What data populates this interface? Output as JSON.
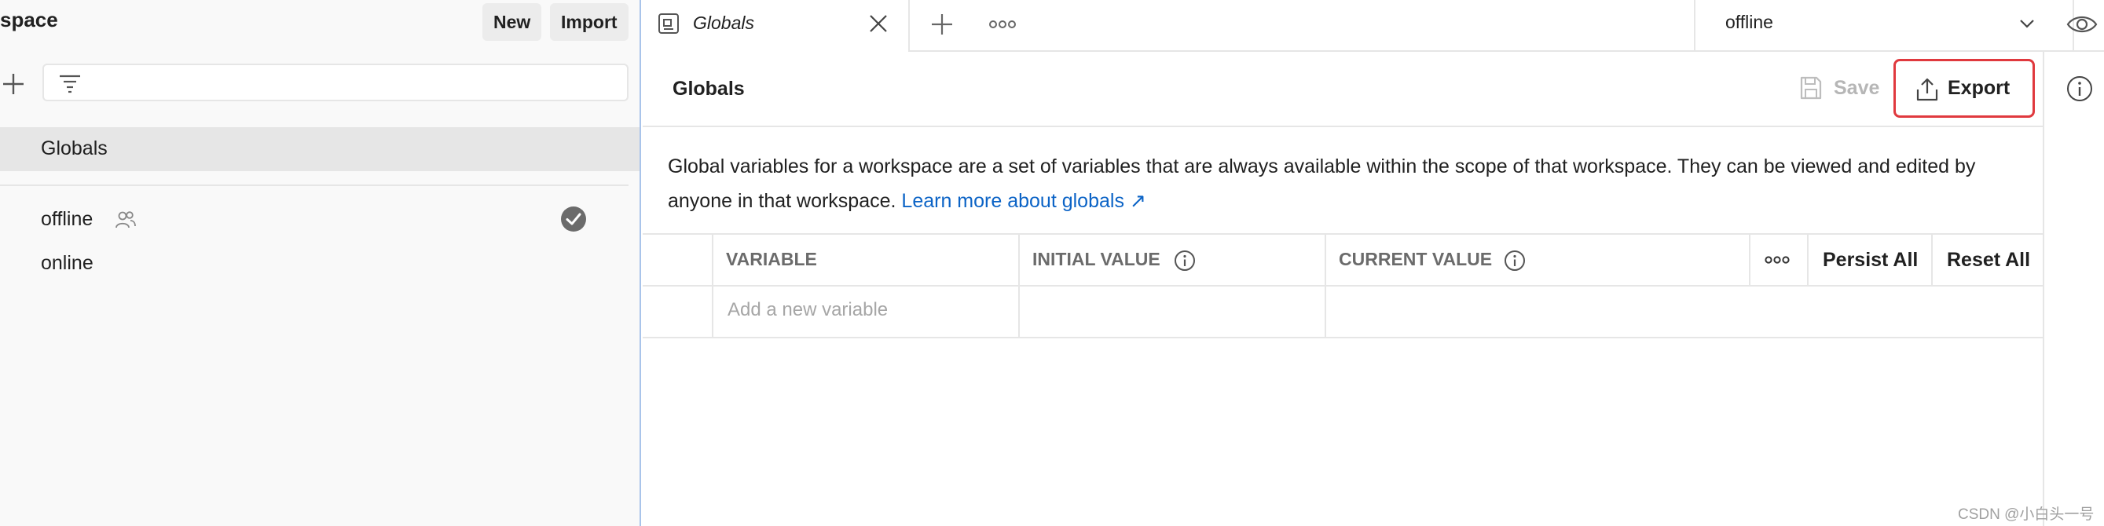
{
  "sidebar": {
    "title": "space",
    "new_label": "New",
    "import_label": "Import",
    "filter_placeholder": "",
    "globals_label": "Globals",
    "environments": [
      {
        "name": "offline",
        "shared": true,
        "active": true
      },
      {
        "name": "online",
        "shared": false,
        "active": false
      }
    ]
  },
  "tabs": [
    {
      "label": "Globals",
      "active": true
    }
  ],
  "environment_selector": {
    "selected": "offline"
  },
  "main": {
    "title": "Globals",
    "save_label": "Save",
    "export_label": "Export",
    "description": "Global variables for a workspace are a set of variables that are always available within the scope of that workspace. They can be viewed and edited by anyone in that workspace.",
    "learn_more_label": "Learn more about globals ↗"
  },
  "table": {
    "headers": {
      "variable": "VARIABLE",
      "initial_value": "INITIAL VALUE",
      "current_value": "CURRENT VALUE",
      "persist_all": "Persist All",
      "reset_all": "Reset All"
    },
    "add_placeholder": "Add a new variable"
  },
  "watermark": "CSDN @小白头一号",
  "colors": {
    "accent_link": "#0b63c6",
    "highlight_border": "#e0393e",
    "sidebar_bg": "#f9f9f9",
    "selected_row_bg": "#e6e6e6"
  }
}
